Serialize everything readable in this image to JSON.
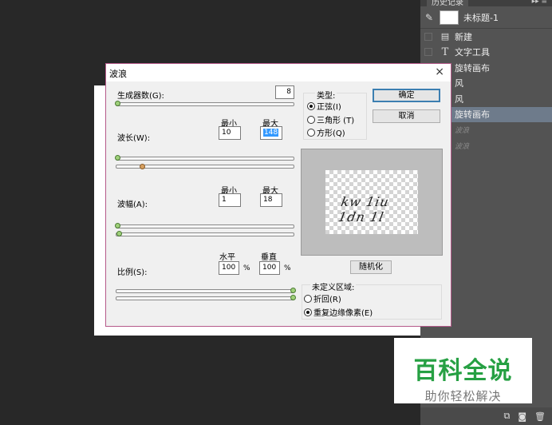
{
  "history_panel": {
    "tab_label": "历史记录",
    "menu_icon": "double-arrow-menu-icon",
    "snapshot_label": "未标题-1",
    "items": [
      {
        "label": "新建",
        "icon": "document-icon",
        "active": false
      },
      {
        "label": "文字工具",
        "icon": "type-tool-icon",
        "active": false
      },
      {
        "label": "旋转画布",
        "icon": "rotate-icon",
        "active": false
      },
      {
        "label": "风",
        "icon": "filter-icon",
        "active": false
      },
      {
        "label": "风",
        "icon": "filter-icon",
        "active": false
      },
      {
        "label": "旋转画布",
        "icon": "rotate-icon",
        "active": true
      },
      {
        "label": "波浪",
        "icon": "filter-icon",
        "active": false
      },
      {
        "label": "波浪",
        "icon": "filter-icon",
        "active": false
      }
    ]
  },
  "dialog": {
    "title": "波浪",
    "close": "×",
    "generators_label": "生成器数(G):",
    "generators_value": "8",
    "min_label": "最小",
    "max_label": "最大",
    "wavelength_label": "波长(W):",
    "wavelength_min": "10",
    "wavelength_max": "148",
    "amplitude_label": "波幅(A):",
    "amplitude_min": "1",
    "amplitude_max": "18",
    "horizontal_label": "水平",
    "vertical_label": "垂直",
    "scale_label": "比例(S):",
    "scale_h": "100",
    "scale_v": "100",
    "percent": "%",
    "type_group_label": "类型:",
    "type_options": [
      {
        "label": "正弦(I)",
        "selected": true
      },
      {
        "label": "三角形 (T)",
        "selected": false
      },
      {
        "label": "方形(Q)",
        "selected": false
      }
    ],
    "ok_label": "确定",
    "cancel_label": "取消",
    "randomize_label": "随机化",
    "undefined_group_label": "未定义区域:",
    "undefined_options": [
      {
        "label": "折回(R)",
        "selected": false
      },
      {
        "label": "重复边缘像素(E)",
        "selected": true
      }
    ],
    "preview_text": "kw 1iu 1dn 1l"
  },
  "watermark": {
    "title": "百科全说",
    "subtitle": "助你轻松解决"
  }
}
